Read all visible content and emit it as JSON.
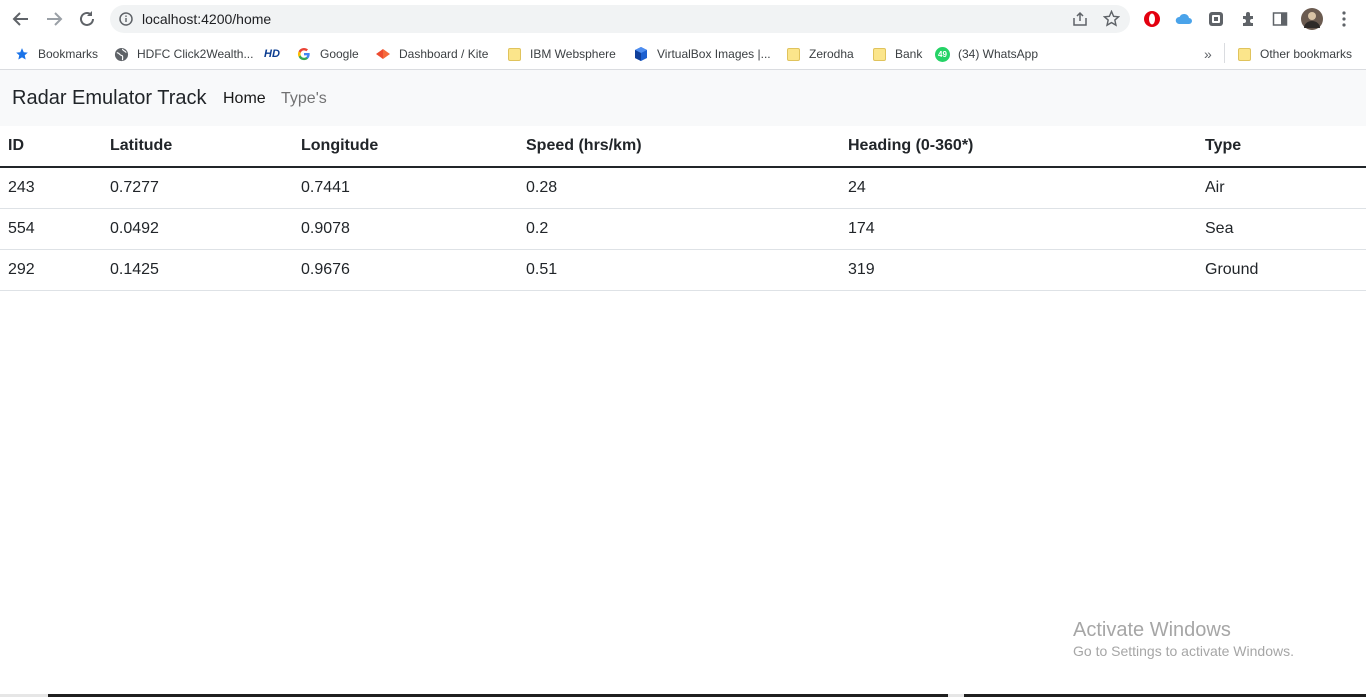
{
  "browser": {
    "url": "localhost:4200/home",
    "bookmarks": [
      {
        "label": "Bookmarks",
        "icon": "star-icon"
      },
      {
        "label": "HDFC Click2Wealth...",
        "icon": "globe-icon"
      },
      {
        "label": "",
        "icon": "hd-icon",
        "icon_text": "HD"
      },
      {
        "label": "Google",
        "icon": "google-icon"
      },
      {
        "label": "Dashboard / Kite",
        "icon": "kite-icon"
      },
      {
        "label": "IBM Websphere",
        "icon": "folder-icon"
      },
      {
        "label": "VirtualBox Images |...",
        "icon": "virtualbox-icon"
      },
      {
        "label": "Zerodha",
        "icon": "folder-icon"
      },
      {
        "label": "Bank",
        "icon": "folder-icon"
      },
      {
        "label": "(34) WhatsApp",
        "icon": "whatsapp-icon",
        "icon_text": "49"
      }
    ],
    "overflow_label": "»",
    "other_bookmarks": "Other bookmarks"
  },
  "app": {
    "brand": "Radar Emulator Track",
    "nav": {
      "home": "Home",
      "types": "Type's"
    }
  },
  "table": {
    "headers": [
      "ID",
      "Latitude",
      "Longitude",
      "Speed (hrs/km)",
      "Heading (0-360*)",
      "Type"
    ],
    "rows": [
      [
        "243",
        "0.7277",
        "0.7441",
        "0.28",
        "24",
        "Air"
      ],
      [
        "554",
        "0.0492",
        "0.9078",
        "0.2",
        "174",
        "Sea"
      ],
      [
        "292",
        "0.1425",
        "0.9676",
        "0.51",
        "319",
        "Ground"
      ]
    ]
  },
  "watermark": {
    "title": "Activate Windows",
    "subtitle": "Go to Settings to activate Windows."
  }
}
